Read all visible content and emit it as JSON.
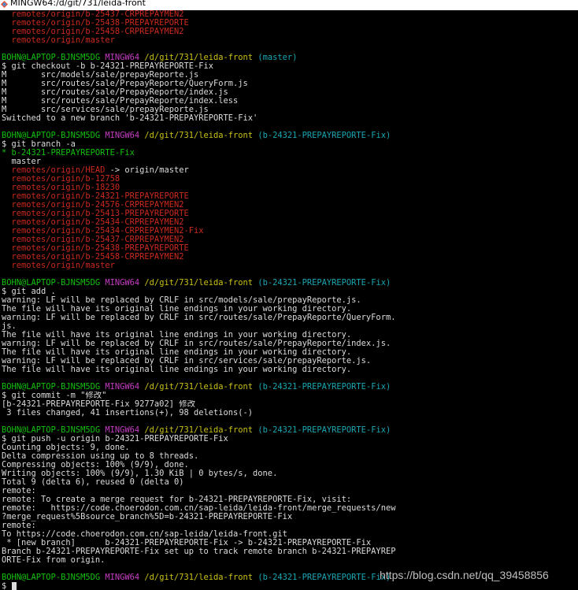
{
  "window": {
    "title": "MINGW64:/d/git/731/leida-front"
  },
  "terminal": {
    "lines": [
      [
        {
          "t": "  remotes/origin/b-25437-CRPREPAYMEN2",
          "c": "red"
        }
      ],
      [
        {
          "t": "  remotes/origin/b-25438-PREPAYREPORTE",
          "c": "red"
        }
      ],
      [
        {
          "t": "  remotes/origin/b-25458-CRPREPAYMEN2",
          "c": "red"
        }
      ],
      [
        {
          "t": "  remotes/origin/master",
          "c": "red"
        }
      ],
      [],
      [
        {
          "t": "BOHN@LAPTOP-BJNSM5DG ",
          "c": "green"
        },
        {
          "t": "MINGW64 ",
          "c": "magenta"
        },
        {
          "t": "/d/git/731/leida-front ",
          "c": "yellow"
        },
        {
          "t": "(master)",
          "c": "cyan"
        }
      ],
      [
        {
          "t": "$ git checkout -b b-24321-PREPAYREPORTE-Fix",
          "c": "white"
        }
      ],
      [
        {
          "t": "M       src/models/sale/prepayReporte.js",
          "c": "white"
        }
      ],
      [
        {
          "t": "M       src/routes/sale/PrepayReporte/QueryForm.js",
          "c": "white"
        }
      ],
      [
        {
          "t": "M       src/routes/sale/PrepayReporte/index.js",
          "c": "white"
        }
      ],
      [
        {
          "t": "M       src/routes/sale/PrepayReporte/index.less",
          "c": "white"
        }
      ],
      [
        {
          "t": "M       src/services/sale/prepayReporte.js",
          "c": "white"
        }
      ],
      [
        {
          "t": "Switched to a new branch 'b-24321-PREPAYREPORTE-Fix'",
          "c": "white"
        }
      ],
      [],
      [
        {
          "t": "BOHN@LAPTOP-BJNSM5DG ",
          "c": "green"
        },
        {
          "t": "MINGW64 ",
          "c": "magenta"
        },
        {
          "t": "/d/git/731/leida-front ",
          "c": "yellow"
        },
        {
          "t": "(b-24321-PREPAYREPORTE-Fix)",
          "c": "cyan"
        }
      ],
      [
        {
          "t": "$ git branch -a",
          "c": "white"
        }
      ],
      [
        {
          "t": "* b-24321-PREPAYREPORTE-Fix",
          "c": "green"
        }
      ],
      [
        {
          "t": "  master",
          "c": "white"
        }
      ],
      [
        {
          "t": "  remotes/origin/HEAD",
          "c": "red"
        },
        {
          "t": " -> origin/master",
          "c": "white"
        }
      ],
      [
        {
          "t": "  remotes/origin/b-12758",
          "c": "red"
        }
      ],
      [
        {
          "t": "  remotes/origin/b-18230",
          "c": "red"
        }
      ],
      [
        {
          "t": "  remotes/origin/b-24321-PREPAYREPORTE",
          "c": "red"
        }
      ],
      [
        {
          "t": "  remotes/origin/b-24576-CRPREPAYMEN2",
          "c": "red"
        }
      ],
      [
        {
          "t": "  remotes/origin/b-25413-PREPAYREPORTE",
          "c": "red"
        }
      ],
      [
        {
          "t": "  remotes/origin/b-25434-CRPREPAYMEN2",
          "c": "red"
        }
      ],
      [
        {
          "t": "  remotes/origin/b-25434-CRPREPAYMEN2-Fix",
          "c": "red"
        }
      ],
      [
        {
          "t": "  remotes/origin/b-25437-CRPREPAYMEN2",
          "c": "red"
        }
      ],
      [
        {
          "t": "  remotes/origin/b-25438-PREPAYREPORTE",
          "c": "red"
        }
      ],
      [
        {
          "t": "  remotes/origin/b-25458-CRPREPAYMEN2",
          "c": "red"
        }
      ],
      [
        {
          "t": "  remotes/origin/master",
          "c": "red"
        }
      ],
      [],
      [
        {
          "t": "BOHN@LAPTOP-BJNSM5DG ",
          "c": "green"
        },
        {
          "t": "MINGW64 ",
          "c": "magenta"
        },
        {
          "t": "/d/git/731/leida-front ",
          "c": "yellow"
        },
        {
          "t": "(b-24321-PREPAYREPORTE-Fix)",
          "c": "cyan"
        }
      ],
      [
        {
          "t": "$ git add .",
          "c": "white"
        }
      ],
      [
        {
          "t": "warning: LF will be replaced by CRLF in src/models/sale/prepayReporte.js.",
          "c": "white"
        }
      ],
      [
        {
          "t": "The file will have its original line endings in your working directory.",
          "c": "white"
        }
      ],
      [
        {
          "t": "warning: LF will be replaced by CRLF in src/routes/sale/PrepayReporte/QueryForm.",
          "c": "white"
        }
      ],
      [
        {
          "t": "js.",
          "c": "white"
        }
      ],
      [
        {
          "t": "The file will have its original line endings in your working directory.",
          "c": "white"
        }
      ],
      [
        {
          "t": "warning: LF will be replaced by CRLF in src/routes/sale/PrepayReporte/index.js.",
          "c": "white"
        }
      ],
      [
        {
          "t": "The file will have its original line endings in your working directory.",
          "c": "white"
        }
      ],
      [
        {
          "t": "warning: LF will be replaced by CRLF in src/services/sale/prepayReporte.js.",
          "c": "white"
        }
      ],
      [
        {
          "t": "The file will have its original line endings in your working directory.",
          "c": "white"
        }
      ],
      [],
      [
        {
          "t": "BOHN@LAPTOP-BJNSM5DG ",
          "c": "green"
        },
        {
          "t": "MINGW64 ",
          "c": "magenta"
        },
        {
          "t": "/d/git/731/leida-front ",
          "c": "yellow"
        },
        {
          "t": "(b-24321-PREPAYREPORTE-Fix)",
          "c": "cyan"
        }
      ],
      [
        {
          "t": "$ git commit -m \"修改\"",
          "c": "white"
        }
      ],
      [
        {
          "t": "[b-24321-PREPAYREPORTE-Fix 9277a02] 修改",
          "c": "white"
        }
      ],
      [
        {
          "t": " 3 files changed, 41 insertions(+), 98 deletions(-)",
          "c": "white"
        }
      ],
      [],
      [
        {
          "t": "BOHN@LAPTOP-BJNSM5DG ",
          "c": "green"
        },
        {
          "t": "MINGW64 ",
          "c": "magenta"
        },
        {
          "t": "/d/git/731/leida-front ",
          "c": "yellow"
        },
        {
          "t": "(b-24321-PREPAYREPORTE-Fix)",
          "c": "cyan"
        }
      ],
      [
        {
          "t": "$ git push -u origin b-24321-PREPAYREPORTE-Fix",
          "c": "white"
        }
      ],
      [
        {
          "t": "Counting objects: 9, done.",
          "c": "white"
        }
      ],
      [
        {
          "t": "Delta compression using up to 8 threads.",
          "c": "white"
        }
      ],
      [
        {
          "t": "Compressing objects: 100% (9/9), done.",
          "c": "white"
        }
      ],
      [
        {
          "t": "Writing objects: 100% (9/9), 1.30 KiB | 0 bytes/s, done.",
          "c": "white"
        }
      ],
      [
        {
          "t": "Total 9 (delta 6), reused 0 (delta 0)",
          "c": "white"
        }
      ],
      [
        {
          "t": "remote:",
          "c": "white"
        }
      ],
      [
        {
          "t": "remote: To create a merge request for b-24321-PREPAYREPORTE-Fix, visit:",
          "c": "white"
        }
      ],
      [
        {
          "t": "remote:   https://code.choerodon.com.cn/sap-leida/leida-front/merge_requests/new",
          "c": "white"
        }
      ],
      [
        {
          "t": "?merge_request%5Bsource_branch%5D=b-24321-PREPAYREPORTE-Fix",
          "c": "white"
        }
      ],
      [
        {
          "t": "remote:",
          "c": "white"
        }
      ],
      [
        {
          "t": "To https://code.choerodon.com.cn/sap-leida/leida-front.git",
          "c": "white"
        }
      ],
      [
        {
          "t": " * [new branch]      b-24321-PREPAYREPORTE-Fix -> b-24321-PREPAYREPORTE-Fix",
          "c": "white"
        }
      ],
      [
        {
          "t": "Branch b-24321-PREPAYREPORTE-Fix set up to track remote branch b-24321-PREPAYREP",
          "c": "white"
        }
      ],
      [
        {
          "t": "ORTE-Fix from origin.",
          "c": "white"
        }
      ],
      [],
      [
        {
          "t": "BOHN@LAPTOP-BJNSM5DG ",
          "c": "green"
        },
        {
          "t": "MINGW64 ",
          "c": "magenta"
        },
        {
          "t": "/d/git/731/leida-front ",
          "c": "yellow"
        },
        {
          "t": "(b-24321-PREPAYREPORTE-Fix)",
          "c": "cyan"
        }
      ],
      [
        {
          "t": "$ ",
          "c": "white"
        }
      ]
    ]
  },
  "watermark": "https://blog.csdn.net/qq_39458856",
  "colors": {
    "background": "#000000",
    "white": "#dcdcdc",
    "red": "#cc2a1f",
    "green": "#13c00e",
    "magenta": "#c53dc2",
    "yellow": "#c9c115",
    "cyan": "#1aa6b2"
  }
}
